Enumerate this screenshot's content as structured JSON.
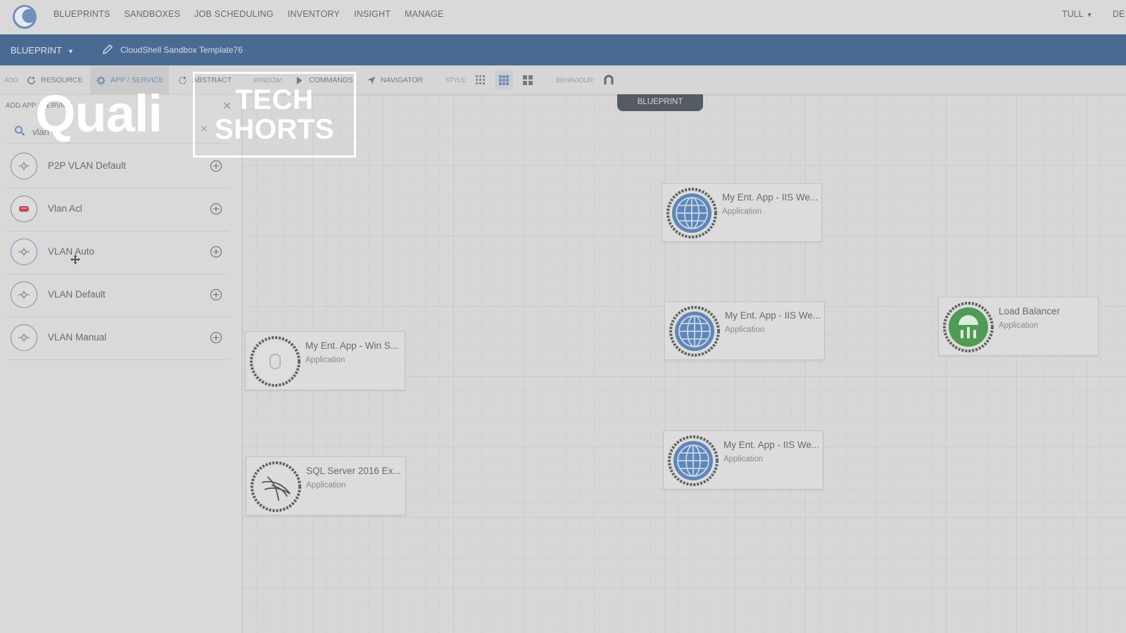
{
  "nav": {
    "items": [
      "BLUEPRINTS",
      "SANDBOXES",
      "JOB SCHEDULING",
      "INVENTORY",
      "INSIGHT",
      "MANAGE"
    ],
    "user": "TULL",
    "user_extra": "DE"
  },
  "blueprint_bar": {
    "dropdown_label": "BLUEPRINT",
    "blueprint_name": "CloudShell Sandbox Template76"
  },
  "toolbar": {
    "add_label": "ADD:",
    "resource": "RESOURCE",
    "app_service": "APP / SERVICE",
    "abstract": "ABSTRACT",
    "window_label": "WINDOW:",
    "commands": "COMMANDS",
    "navigator": "NAVIGATOR",
    "style_label": "STYLE:",
    "behaviour_label": "BEHAVIOUR:"
  },
  "left_panel": {
    "title": "ADD APP / SERVICE",
    "search_value": "vlan",
    "items": [
      {
        "label": "P2P VLAN Default",
        "icon": "vlan-icon"
      },
      {
        "label": "Vlan Acl",
        "icon": "acl-icon"
      },
      {
        "label": "VLAN Auto",
        "icon": "vlan-icon"
      },
      {
        "label": "VLAN Default",
        "icon": "vlan-icon"
      },
      {
        "label": "VLAN Manual",
        "icon": "vlan-icon"
      }
    ]
  },
  "canvas": {
    "tab_label": "BLUEPRINT",
    "cards": [
      {
        "title": "My Ent. App - IIS We...",
        "subtitle": "Application",
        "icon": "globe-icon"
      },
      {
        "title": "My Ent. App - IIS We...",
        "subtitle": "Application",
        "icon": "globe-icon"
      },
      {
        "title": "Load Balancer",
        "subtitle": "Application",
        "icon": "load-balancer-icon"
      },
      {
        "title": "My Ent. App - Win S...",
        "subtitle": "Application",
        "icon": "windows-server-icon"
      },
      {
        "title": "My Ent. App - IIS We...",
        "subtitle": "Application",
        "icon": "globe-icon"
      },
      {
        "title": "SQL Server 2016 Ex...",
        "subtitle": "Application",
        "icon": "sql-server-icon"
      }
    ]
  },
  "overlay": {
    "brand": "Quali",
    "tech_line1": "TECH",
    "tech_line2": "SHORTS"
  },
  "colors": {
    "blueprint_bar": "#4a6a93",
    "accent_blue": "#5f86b8",
    "load_balancer_green": "#4f9a55"
  }
}
